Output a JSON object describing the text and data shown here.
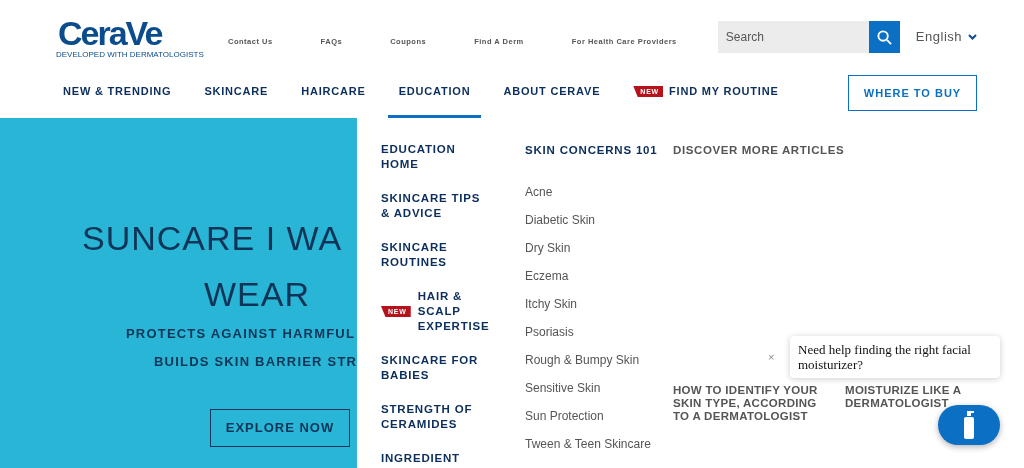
{
  "header": {
    "logo": {
      "name": "CeraVe",
      "tagline": "DEVELOPED WITH DERMATOLOGISTS"
    },
    "utility_links": [
      "Contact Us",
      "FAQs",
      "Coupons",
      "Find A Derm",
      "For Health Care Providers"
    ],
    "search": {
      "placeholder": "Search"
    },
    "language": "English",
    "nav": [
      {
        "label": "NEW & TRENDING",
        "selected": false
      },
      {
        "label": "SKINCARE",
        "selected": false
      },
      {
        "label": "HAIRCARE",
        "selected": false
      },
      {
        "label": "EDUCATION",
        "selected": true
      },
      {
        "label": "ABOUT CERAVE",
        "selected": false
      },
      {
        "label": "FIND MY ROUTINE",
        "selected": false,
        "badge": "NEW"
      }
    ],
    "cta": "WHERE TO BUY"
  },
  "hero": {
    "headline": [
      "SUNCARE I WA",
      "WEAR"
    ],
    "subline": [
      "PROTECTS AGAINST HARMFUL",
      "BUILDS SKIN BARRIER STR"
    ],
    "button": "EXPLORE NOW"
  },
  "menu": {
    "sections": [
      {
        "label": "EDUCATION HOME"
      },
      {
        "label": "SKINCARE TIPS & ADVICE"
      },
      {
        "label": "SKINCARE ROUTINES"
      },
      {
        "label": "HAIR & SCALP EXPERTISE",
        "badge": "NEW"
      },
      {
        "label": "SKINCARE FOR BABIES"
      },
      {
        "label": "STRENGTH OF CERAMIDES"
      },
      {
        "label": "INGREDIENT"
      }
    ],
    "concerns": {
      "title": "SKIN CONCERNS 101",
      "items": [
        "Acne",
        "Diabetic Skin",
        "Dry Skin",
        "Eczema",
        "Itchy Skin",
        "Psoriasis",
        "Rough & Bumpy Skin",
        "Sensitive Skin",
        "Sun Protection",
        "Tween & Teen Skincare"
      ]
    },
    "articles": {
      "title": "DISCOVER MORE ARTICLES",
      "items": [
        "HOW TO IDENTIFY YOUR SKIN TYPE, ACCORDING TO A DERMATOLOGIST",
        "MOISTURIZE LIKE A DERMATOLOGIST"
      ]
    }
  },
  "chat": {
    "close": "×",
    "message": "Need help finding the right facial moisturizer?"
  }
}
